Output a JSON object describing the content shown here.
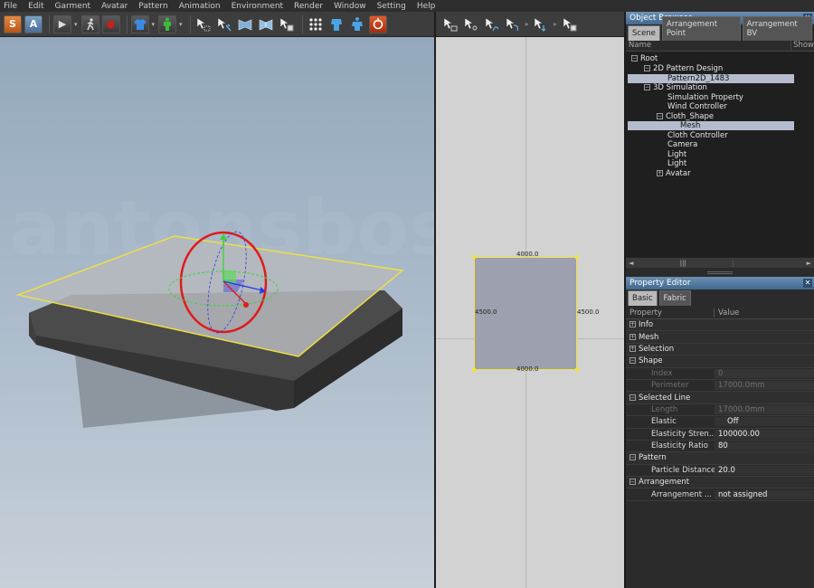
{
  "menu": [
    "File",
    "Edit",
    "Garment",
    "Avatar",
    "Pattern",
    "Animation",
    "Environment",
    "Render",
    "Window",
    "Setting",
    "Help"
  ],
  "toolbar": {
    "mode_s": "S",
    "mode_a": "A",
    "play": "▶",
    "record": "●",
    "icons": [
      "mode-simulation-icon",
      "mode-animation-icon",
      "play-icon",
      "walk-icon",
      "record-icon",
      "garment-shirt-icon",
      "avatar-icon",
      "select-mesh-icon",
      "transform-pin-icon",
      "fold-icon",
      "fold-arrange-icon",
      "arrange-icon",
      "points-icon",
      "avatar-back-icon",
      "avatar-front-icon",
      "reset-icon"
    ]
  },
  "toolbar2d": {
    "overflow1": "»",
    "overflow2": "»"
  },
  "viewport2d": {
    "top": "4000.0",
    "bottom": "4000.0",
    "left": "4500.0",
    "right": "4500.0"
  },
  "object_browser": {
    "title": "Object Browser",
    "tabs": [
      "Scene",
      "Arrangement Point",
      "Arrangement BV"
    ],
    "col_name": "Name",
    "col_show": "Show",
    "tree": [
      {
        "label": "Root",
        "exp": "−"
      },
      {
        "label": "2D Pattern Design",
        "exp": "−"
      },
      {
        "label": "Pattern2D_1483",
        "exp": ""
      },
      {
        "label": "3D Simulation",
        "exp": "−"
      },
      {
        "label": "Simulation Property",
        "exp": ""
      },
      {
        "label": "Wind Controller",
        "exp": ""
      },
      {
        "label": "Cloth_Shape",
        "exp": "−"
      },
      {
        "label": "Mesh",
        "exp": ""
      },
      {
        "label": "Cloth Controller",
        "exp": ""
      },
      {
        "label": "Camera",
        "exp": ""
      },
      {
        "label": "Light",
        "exp": ""
      },
      {
        "label": "Light",
        "exp": ""
      },
      {
        "label": "Avatar",
        "exp": "+"
      }
    ],
    "scroll_left": "◄",
    "scroll_mid": "|||",
    "scroll_right": "►"
  },
  "property_editor": {
    "title": "Property Editor",
    "tabs": [
      "Basic",
      "Fabric"
    ],
    "col_property": "Property",
    "col_value": "Value",
    "rows": [
      {
        "name": "Info",
        "value": "",
        "exp": "+"
      },
      {
        "name": "Mesh",
        "value": "",
        "exp": "+"
      },
      {
        "name": "Selection",
        "value": "",
        "exp": "+"
      },
      {
        "name": "Shape",
        "value": "",
        "exp": "−"
      },
      {
        "name": "Index",
        "value": "0",
        "exp": ""
      },
      {
        "name": "Perimeter",
        "value": "17000.0mm",
        "exp": ""
      },
      {
        "name": "Selected Line",
        "value": "",
        "exp": "−"
      },
      {
        "name": "Length",
        "value": "17000.0mm",
        "exp": ""
      },
      {
        "name": "Elastic",
        "value": "Off",
        "exp": ""
      },
      {
        "name": "Elasticity Stren...",
        "value": "100000.00",
        "exp": ""
      },
      {
        "name": "Elasticity Ratio",
        "value": "80",
        "exp": ""
      },
      {
        "name": "Pattern",
        "value": "",
        "exp": "−"
      },
      {
        "name": "Particle Distance",
        "value": "20.0",
        "exp": ""
      },
      {
        "name": "Arrangement",
        "value": "",
        "exp": "−"
      },
      {
        "name": "Arrangement ...",
        "value": "not assigned",
        "exp": ""
      }
    ]
  },
  "colors": {
    "panel_title": "#4f77a0",
    "selection": "#b4bccd",
    "pattern_outline": "#f2e23a",
    "gizmo_red": "#e01a1a"
  }
}
